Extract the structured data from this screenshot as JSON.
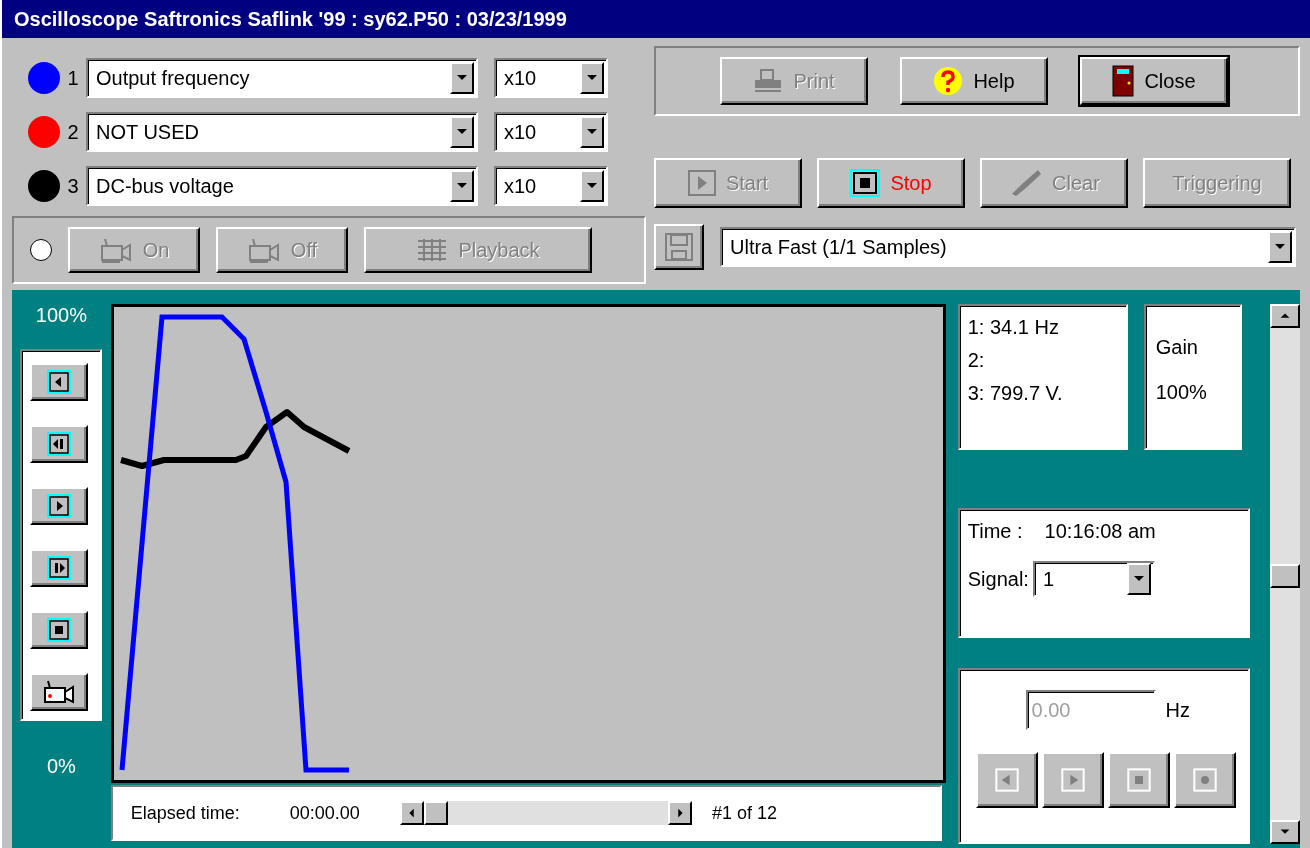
{
  "window": {
    "title": "Oscilloscope Saftronics Saflink '99 : sy62.P50 : 03/23/1999"
  },
  "channels": [
    {
      "number": "1",
      "color": "#0000ff",
      "signal": "Output frequency",
      "scale": "x10"
    },
    {
      "number": "2",
      "color": "#ff0000",
      "signal": "NOT USED",
      "scale": "x10"
    },
    {
      "number": "3",
      "color": "#000000",
      "signal": "DC-bus voltage",
      "scale": "x10"
    }
  ],
  "recorder": {
    "on": false,
    "buttons": [
      {
        "label": "On",
        "disabled": true
      },
      {
        "label": "Off",
        "disabled": true
      },
      {
        "label": "Playback",
        "disabled": true
      }
    ]
  },
  "top_buttons": [
    {
      "label": "Print",
      "disabled": true,
      "default": false
    },
    {
      "label": "Help",
      "disabled": false,
      "default": false
    },
    {
      "label": "Close",
      "disabled": false,
      "default": true
    }
  ],
  "capture_buttons": [
    {
      "label": "Start",
      "disabled": true
    },
    {
      "label": "Stop",
      "disabled": false,
      "color": "#ff0000"
    },
    {
      "label": "Clear",
      "disabled": true
    },
    {
      "label": "Triggering",
      "disabled": true
    }
  ],
  "save": {
    "disabled": true
  },
  "speed": {
    "value": "Ultra Fast (1/1 Samples)"
  },
  "plot": {
    "y_max_label": "100%",
    "y_min_label": "0%"
  },
  "transport": [
    {
      "disabled": false
    },
    {
      "disabled": false
    },
    {
      "disabled": false
    },
    {
      "disabled": false
    },
    {
      "disabled": false
    },
    {
      "disabled": false
    }
  ],
  "elapsed": {
    "label": "Elapsed time:",
    "value": "00:00.00",
    "position": "#1 of 12"
  },
  "readings": [
    "1: 34.1 Hz",
    "2:",
    "3: 799.7 V."
  ],
  "gain": {
    "label": "Gain",
    "value": "100%"
  },
  "time": {
    "label": "Time :",
    "value": "10:16:08 am"
  },
  "signal": {
    "label": "Signal:",
    "value": "1"
  },
  "frequency": {
    "value": "0.00",
    "unit": "Hz",
    "disabled": true,
    "buttons": [
      {
        "disabled": true
      },
      {
        "disabled": true
      },
      {
        "disabled": true
      },
      {
        "disabled": true
      }
    ]
  }
}
